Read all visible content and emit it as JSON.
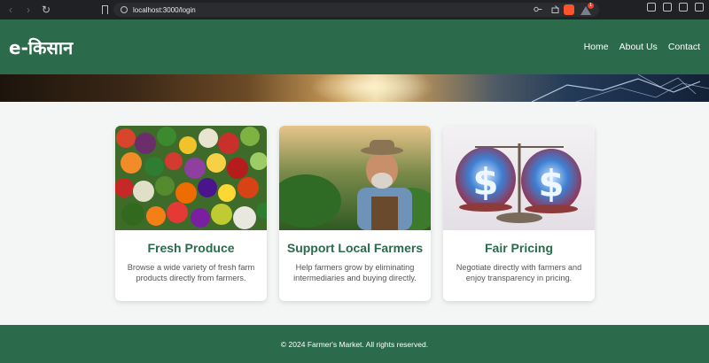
{
  "browser": {
    "url": "localhost:3000/login",
    "rewards_badge": "1"
  },
  "header": {
    "logo": "e-किसान",
    "nav": [
      "Home",
      "About Us",
      "Contact"
    ]
  },
  "cards": [
    {
      "title": "Fresh Produce",
      "description": "Browse a wide variety of fresh farm products directly from farmers."
    },
    {
      "title": "Support Local Farmers",
      "description": "Help farmers grow by eliminating intermediaries and buying directly."
    },
    {
      "title": "Fair Pricing",
      "description": "Negotiate directly with farmers and enjoy transparency in pricing."
    }
  ],
  "footer": {
    "text": "© 2024 Farmer's Market. All rights reserved."
  },
  "colors": {
    "brand_green": "#2b6a4b",
    "page_bg": "#f4f6f5",
    "card_text": "#555555"
  }
}
